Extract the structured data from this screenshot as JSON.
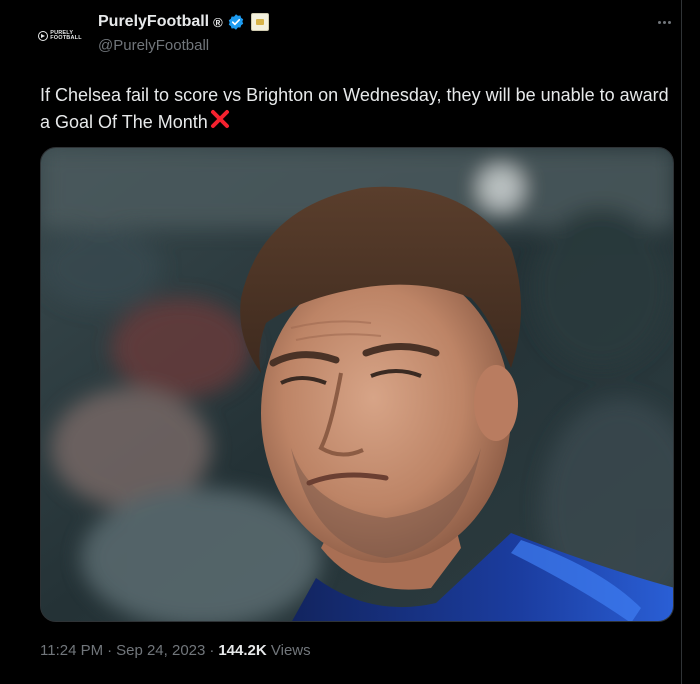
{
  "author": {
    "display_name": "PurelyFootball",
    "registered_mark": "®",
    "handle": "@PurelyFootball",
    "avatar_logo_text": [
      "PURELY",
      "FOOTBALL"
    ],
    "icons": [
      "verified-badge-icon",
      "affiliate-badge-icon"
    ]
  },
  "tweet": {
    "text": "If Chelsea fail to score vs Brighton on Wednesday, they will be unable to award a Goal Of The Month",
    "emoji": "cross-mark-icon"
  },
  "meta": {
    "time": "11:24 PM",
    "separator": "·",
    "date": "Sep 24, 2023",
    "views_count": "144.2K",
    "views_label": "Views"
  },
  "colors": {
    "background": "#000000",
    "text": "#e7e9ea",
    "secondary": "#71767b",
    "verified": "#1d9bf0",
    "cross": "#f4212e"
  }
}
